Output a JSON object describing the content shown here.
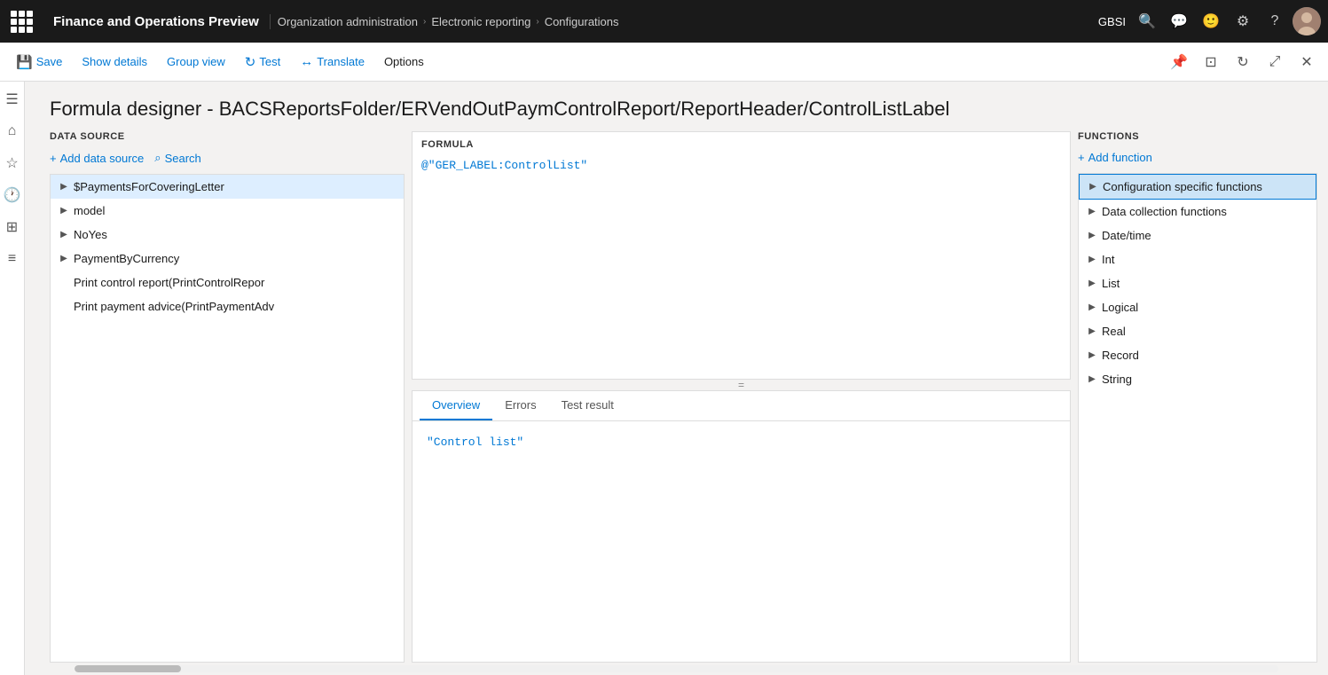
{
  "app": {
    "title": "Finance and Operations Preview",
    "org_code": "GBSI"
  },
  "breadcrumb": {
    "items": [
      {
        "label": "Organization administration"
      },
      {
        "label": "Electronic reporting"
      },
      {
        "label": "Configurations"
      }
    ]
  },
  "toolbar": {
    "save_label": "Save",
    "show_details_label": "Show details",
    "group_view_label": "Group view",
    "test_label": "Test",
    "translate_label": "Translate",
    "options_label": "Options"
  },
  "page": {
    "title": "Formula designer - BACSReportsFolder/ERVendOutPaymControlReport/ReportHeader/ControlListLabel"
  },
  "data_source": {
    "header": "DATA SOURCE",
    "add_label": "+ Add data source",
    "search_label": "Search",
    "items": [
      {
        "label": "$PaymentsForCoveringLetter",
        "has_children": true,
        "selected": true
      },
      {
        "label": "model",
        "has_children": true,
        "selected": false
      },
      {
        "label": "NoYes",
        "has_children": true,
        "selected": false
      },
      {
        "label": "PaymentByCurrency",
        "has_children": true,
        "selected": false
      },
      {
        "label": "Print control report(PrintControlRepor",
        "has_children": false,
        "selected": false
      },
      {
        "label": "Print payment advice(PrintPaymentAdv",
        "has_children": false,
        "selected": false
      }
    ]
  },
  "formula": {
    "header": "FORMULA",
    "value": "@\"GER_LABEL:ControlList\""
  },
  "bottom_tabs": {
    "tabs": [
      {
        "label": "Overview",
        "active": true
      },
      {
        "label": "Errors",
        "active": false
      },
      {
        "label": "Test result",
        "active": false
      }
    ],
    "content": "\"Control list\""
  },
  "functions": {
    "header": "FUNCTIONS",
    "add_label": "+ Add function",
    "items": [
      {
        "label": "Configuration specific functions",
        "has_children": true,
        "selected": true
      },
      {
        "label": "Data collection functions",
        "has_children": true,
        "selected": false
      },
      {
        "label": "Date/time",
        "has_children": true,
        "selected": false
      },
      {
        "label": "Int",
        "has_children": true,
        "selected": false
      },
      {
        "label": "List",
        "has_children": true,
        "selected": false
      },
      {
        "label": "Logical",
        "has_children": true,
        "selected": false
      },
      {
        "label": "Real",
        "has_children": true,
        "selected": false
      },
      {
        "label": "Record",
        "has_children": true,
        "selected": false
      },
      {
        "label": "String",
        "has_children": true,
        "selected": false
      }
    ]
  },
  "icons": {
    "grid": "⊞",
    "search": "🔍",
    "chat": "💬",
    "smiley": "🙂",
    "gear": "⚙",
    "question": "?",
    "save": "💾",
    "refresh": "↻",
    "expand": "⤢",
    "close": "✕",
    "pin": "📌",
    "layout": "⊡",
    "hamburger": "☰",
    "home": "⌂",
    "star": "★",
    "clock": "🕐",
    "grid2": "⊞",
    "list": "☰",
    "chevron_right": "▶",
    "plus": "+",
    "search2": "⌕",
    "resize": "="
  }
}
